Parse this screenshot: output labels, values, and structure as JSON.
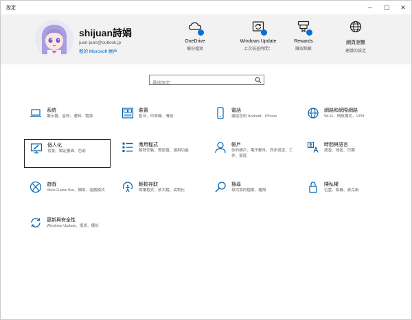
{
  "window": {
    "title": "設定",
    "minimize": "─",
    "maximize": "☐",
    "close": "✕"
  },
  "account": {
    "name": "shijuan詩娟",
    "email": "juan-juan@outlook.jp",
    "microsoft_account_link": "我的 Microsoft 帳戶"
  },
  "quick_links": [
    {
      "title": "OneDrive",
      "subtitle": "備份檔案",
      "icon": "cloud-icon"
    },
    {
      "title": "Windows Update",
      "subtitle": "上次檢查時間：",
      "icon": "update-icon"
    },
    {
      "title": "Rewards",
      "subtitle": "賺取點數",
      "icon": "rewards-icon"
    },
    {
      "title": "網頁瀏覽",
      "subtitle": "建議的設定",
      "icon": "globe-icon"
    }
  ],
  "search": {
    "placeholder": "尋找設定"
  },
  "categories": [
    {
      "title": "系統",
      "desc": "顯示器、音效、通知、電源",
      "icon": "laptop-icon"
    },
    {
      "title": "裝置",
      "desc": "藍牙、印表機、滑鼠",
      "icon": "keyboard-icon"
    },
    {
      "title": "電話",
      "desc": "連結您的 Android、iPhone",
      "icon": "phone-icon"
    },
    {
      "title": "網路和網際網路",
      "desc": "Wi-Fi、飛航模式、VPN",
      "icon": "globe-icon"
    },
    {
      "title": "個人化",
      "desc": "背景、鎖定畫面、色彩",
      "icon": "personalization-icon"
    },
    {
      "title": "應用程式",
      "desc": "解除安裝、預設值、選用功能",
      "icon": "apps-icon"
    },
    {
      "title": "帳戶",
      "desc": "你的帳戶、電子郵件、同步設定、工作、家庭",
      "icon": "person-icon"
    },
    {
      "title": "時間與語言",
      "desc": "語音、地區、日期",
      "icon": "time-language-icon"
    },
    {
      "title": "遊戲",
      "desc": "Xbox Game Bar、擷取、遊戲模式",
      "icon": "xbox-icon"
    },
    {
      "title": "輕鬆存取",
      "desc": "朗讀程式、放大鏡、高對比",
      "icon": "accessibility-icon"
    },
    {
      "title": "搜尋",
      "desc": "尋找我的檔案、權限",
      "icon": "search-icon"
    },
    {
      "title": "隱私權",
      "desc": "位置、相機、麥克風",
      "icon": "lock-icon"
    },
    {
      "title": "更新與安全性",
      "desc": "Windows Update、復原、備份",
      "icon": "sync-icon"
    }
  ],
  "colors": {
    "accent": "#0a6fd8",
    "header_bg": "#f2f2f2",
    "icon": "#0063b1"
  }
}
